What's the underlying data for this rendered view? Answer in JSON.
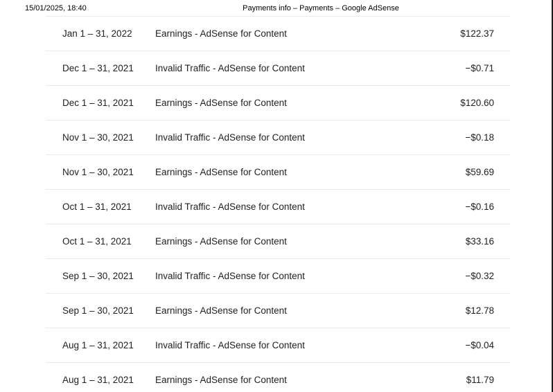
{
  "print_header": {
    "datetime": "15/01/2025, 18:40",
    "title": "Payments info – Payments – Google AdSense"
  },
  "transactions": [
    {
      "date": "Jan 1 – 31, 2022",
      "description": "Earnings - AdSense for Content",
      "amount": "$122.37"
    },
    {
      "date": "Dec 1 – 31, 2021",
      "description": "Invalid Traffic - AdSense for Content",
      "amount": "−$0.71"
    },
    {
      "date": "Dec 1 – 31, 2021",
      "description": "Earnings - AdSense for Content",
      "amount": "$120.60"
    },
    {
      "date": "Nov 1 – 30, 2021",
      "description": "Invalid Traffic - AdSense for Content",
      "amount": "−$0.18"
    },
    {
      "date": "Nov 1 – 30, 2021",
      "description": "Earnings - AdSense for Content",
      "amount": "$59.69"
    },
    {
      "date": "Oct 1 – 31, 2021",
      "description": "Invalid Traffic - AdSense for Content",
      "amount": "−$0.16"
    },
    {
      "date": "Oct 1 – 31, 2021",
      "description": "Earnings - AdSense for Content",
      "amount": "$33.16"
    },
    {
      "date": "Sep 1 – 30, 2021",
      "description": "Invalid Traffic - AdSense for Content",
      "amount": "−$0.32"
    },
    {
      "date": "Sep 1 – 30, 2021",
      "description": "Earnings - AdSense for Content",
      "amount": "$12.78"
    },
    {
      "date": "Aug 1 – 31, 2021",
      "description": "Invalid Traffic - AdSense for Content",
      "amount": "−$0.04"
    },
    {
      "date": "Aug 1 – 31, 2021",
      "description": "Earnings - AdSense for Content",
      "amount": "$11.79"
    }
  ]
}
